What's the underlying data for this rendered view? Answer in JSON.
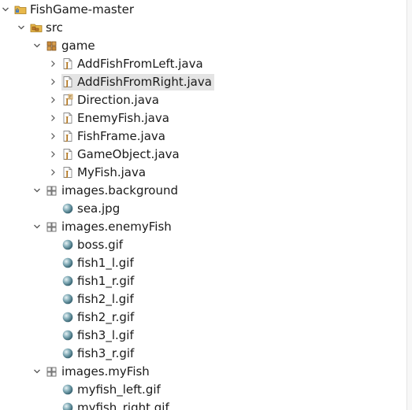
{
  "tree": {
    "nodes": [
      {
        "label": "FishGame-master",
        "depth": 0,
        "twisty": "expanded",
        "icon": "project-folder-icon"
      },
      {
        "label": "src",
        "depth": 1,
        "twisty": "expanded",
        "icon": "source-folder-icon"
      },
      {
        "label": "game",
        "depth": 2,
        "twisty": "expanded",
        "icon": "package-icon"
      },
      {
        "label": "AddFishFromLeft.java",
        "depth": 3,
        "twisty": "collapsed",
        "icon": "java-file-icon"
      },
      {
        "label": "AddFishFromRight.java",
        "depth": 3,
        "twisty": "collapsed",
        "icon": "java-file-icon",
        "selected": true
      },
      {
        "label": "Direction.java",
        "depth": 3,
        "twisty": "collapsed",
        "icon": "java-enum-file-icon"
      },
      {
        "label": "EnemyFish.java",
        "depth": 3,
        "twisty": "collapsed",
        "icon": "java-file-icon"
      },
      {
        "label": "FishFrame.java",
        "depth": 3,
        "twisty": "collapsed",
        "icon": "java-file-icon"
      },
      {
        "label": "GameObject.java",
        "depth": 3,
        "twisty": "collapsed",
        "icon": "java-file-icon"
      },
      {
        "label": "MyFish.java",
        "depth": 3,
        "twisty": "collapsed",
        "icon": "java-file-icon"
      },
      {
        "label": "images.background",
        "depth": 2,
        "twisty": "expanded",
        "icon": "resource-package-icon"
      },
      {
        "label": "sea.jpg",
        "depth": 3,
        "twisty": "none",
        "icon": "image-file-icon"
      },
      {
        "label": "images.enemyFish",
        "depth": 2,
        "twisty": "expanded",
        "icon": "resource-package-icon"
      },
      {
        "label": "boss.gif",
        "depth": 3,
        "twisty": "none",
        "icon": "image-file-icon"
      },
      {
        "label": "fish1_l.gif",
        "depth": 3,
        "twisty": "none",
        "icon": "image-file-icon"
      },
      {
        "label": "fish1_r.gif",
        "depth": 3,
        "twisty": "none",
        "icon": "image-file-icon"
      },
      {
        "label": "fish2_l.gif",
        "depth": 3,
        "twisty": "none",
        "icon": "image-file-icon"
      },
      {
        "label": "fish2_r.gif",
        "depth": 3,
        "twisty": "none",
        "icon": "image-file-icon"
      },
      {
        "label": "fish3_l.gif",
        "depth": 3,
        "twisty": "none",
        "icon": "image-file-icon"
      },
      {
        "label": "fish3_r.gif",
        "depth": 3,
        "twisty": "none",
        "icon": "image-file-icon"
      },
      {
        "label": "images.myFish",
        "depth": 2,
        "twisty": "expanded",
        "icon": "resource-package-icon"
      },
      {
        "label": "myfish_left.gif",
        "depth": 3,
        "twisty": "none",
        "icon": "image-file-icon"
      },
      {
        "label": "myfish_right.gif",
        "depth": 3,
        "twisty": "none",
        "icon": "image-file-icon"
      }
    ]
  },
  "colors": {
    "selection": "#e4e4e4",
    "text": "#1a1a1a",
    "twisty": "#555555"
  }
}
